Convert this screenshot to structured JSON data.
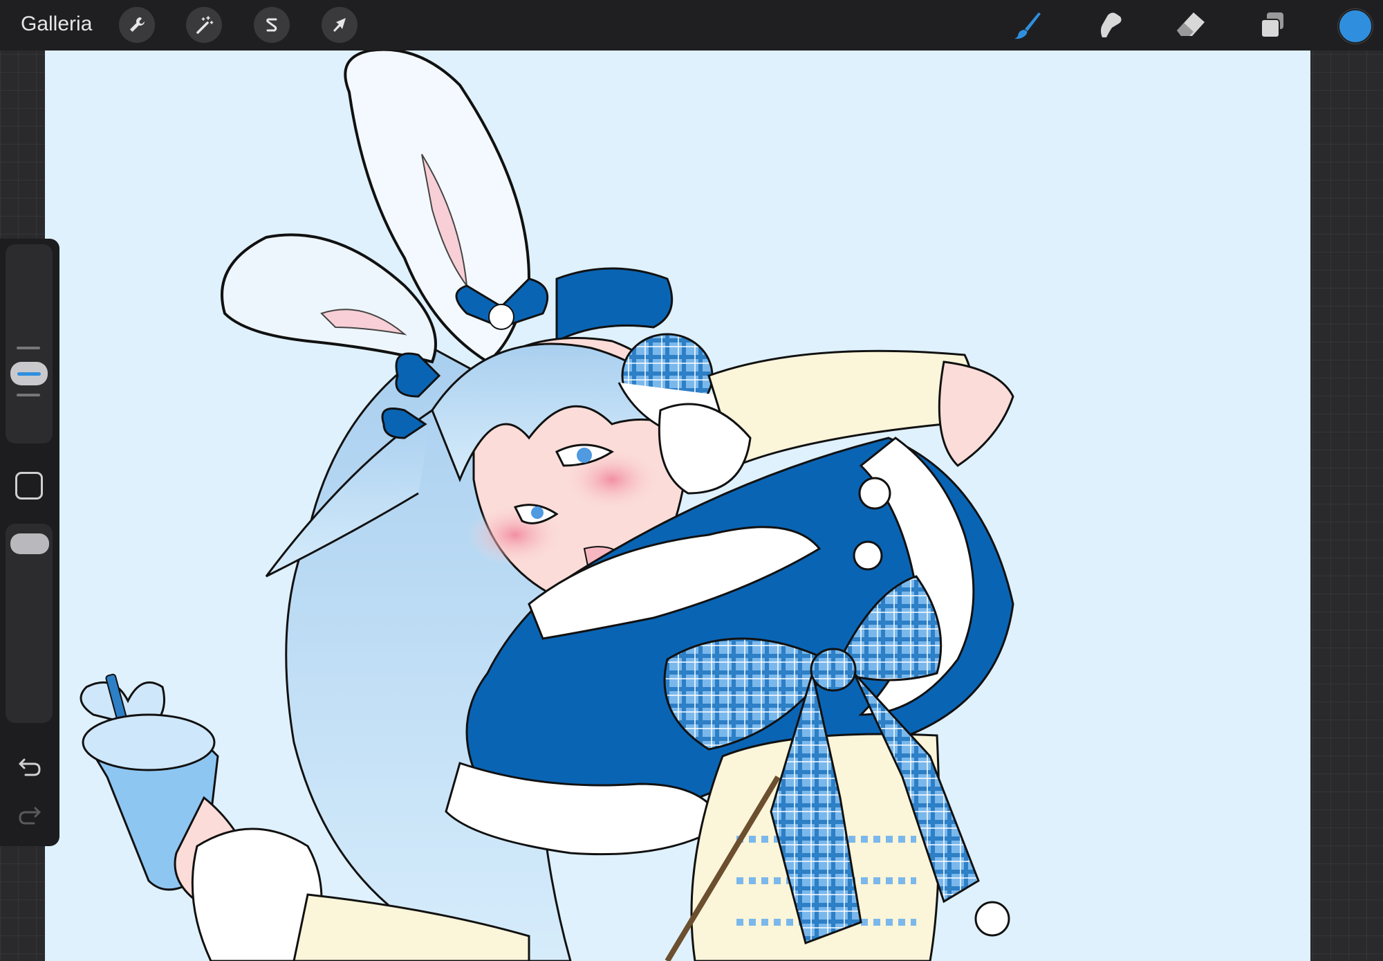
{
  "topbar": {
    "gallery_label": "Galleria",
    "tools_left": [
      {
        "name": "actions",
        "icon": "wrench-icon"
      },
      {
        "name": "adjustments",
        "icon": "magic-wand-icon"
      },
      {
        "name": "selection",
        "icon": "selection-s-icon"
      },
      {
        "name": "transform",
        "icon": "arrow-cursor-icon"
      }
    ],
    "tools_right": [
      {
        "name": "brush",
        "icon": "brush-icon",
        "active": true
      },
      {
        "name": "smudge",
        "icon": "smudge-icon",
        "active": false
      },
      {
        "name": "eraser",
        "icon": "eraser-icon",
        "active": false
      },
      {
        "name": "layers",
        "icon": "layers-icon",
        "active": false
      }
    ],
    "current_color": "#2f8fde"
  },
  "sidebar": {
    "brush_size_level": 0.55,
    "opacity_level": 0.95,
    "undo_icon": "undo-icon",
    "redo_icon": "redo-icon",
    "modify_icon": "square-icon"
  },
  "canvas": {
    "background_color": "#dff1fd",
    "accent_dark_blue": "#0a64b4",
    "hair_color": "#b3d6f2",
    "skin_color": "#fbdcd8",
    "sweater_color": "#fbf5d9"
  }
}
